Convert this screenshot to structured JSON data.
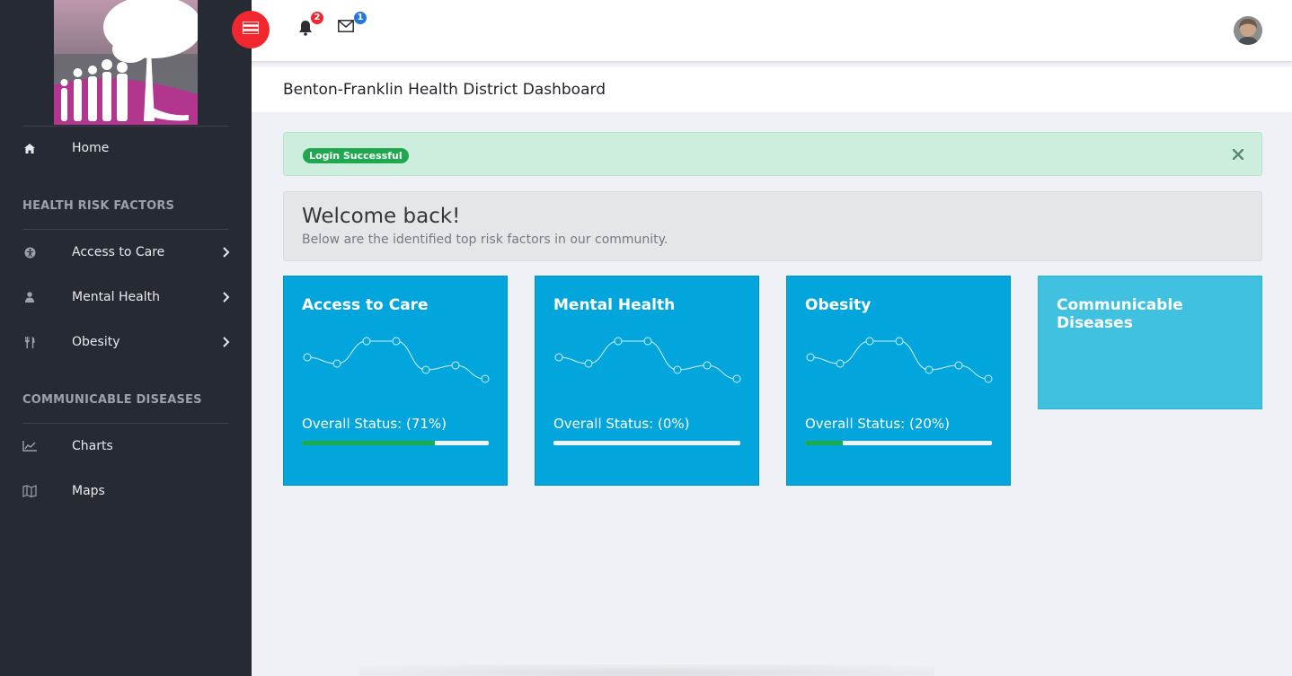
{
  "sidebar": {
    "home": {
      "label": "Home",
      "icon": "home-icon"
    },
    "section1": "HEALTH RISK FACTORS",
    "risk_items": [
      {
        "label": "Access to Care",
        "icon": "universal-access-icon"
      },
      {
        "label": "Mental Health",
        "icon": "user-icon"
      },
      {
        "label": "Obesity",
        "icon": "cutlery-icon"
      }
    ],
    "section2": "COMMUNICABLE DISEASES",
    "disease_items": [
      {
        "label": "Charts",
        "icon": "line-chart-icon"
      },
      {
        "label": "Maps",
        "icon": "map-icon"
      }
    ]
  },
  "topbar": {
    "notifications_count": "2",
    "messages_count": "1"
  },
  "page": {
    "title": "Benton-Franklin Health District Dashboard"
  },
  "alert": {
    "badge": "Login Successful",
    "close": "✕"
  },
  "welcome": {
    "heading": "Welcome back!",
    "subtitle": "Below are the identified top risk factors in our community."
  },
  "cards": [
    {
      "title": "Access to Care",
      "status": "Overall Status: (71%)",
      "progress": 0.71
    },
    {
      "title": "Mental Health",
      "status": "Overall Status: (0%)",
      "progress": 0.0
    },
    {
      "title": "Obesity",
      "status": "Overall Status: (20%)",
      "progress": 0.2
    },
    {
      "title": "Communicable Diseases"
    }
  ],
  "colors": {
    "sidebar_bg": "#262a33",
    "accent_red": "#f0272f",
    "card_blue": "#03a6dc",
    "card_light_blue": "#40c1e0",
    "success_green": "#1aab4a"
  }
}
